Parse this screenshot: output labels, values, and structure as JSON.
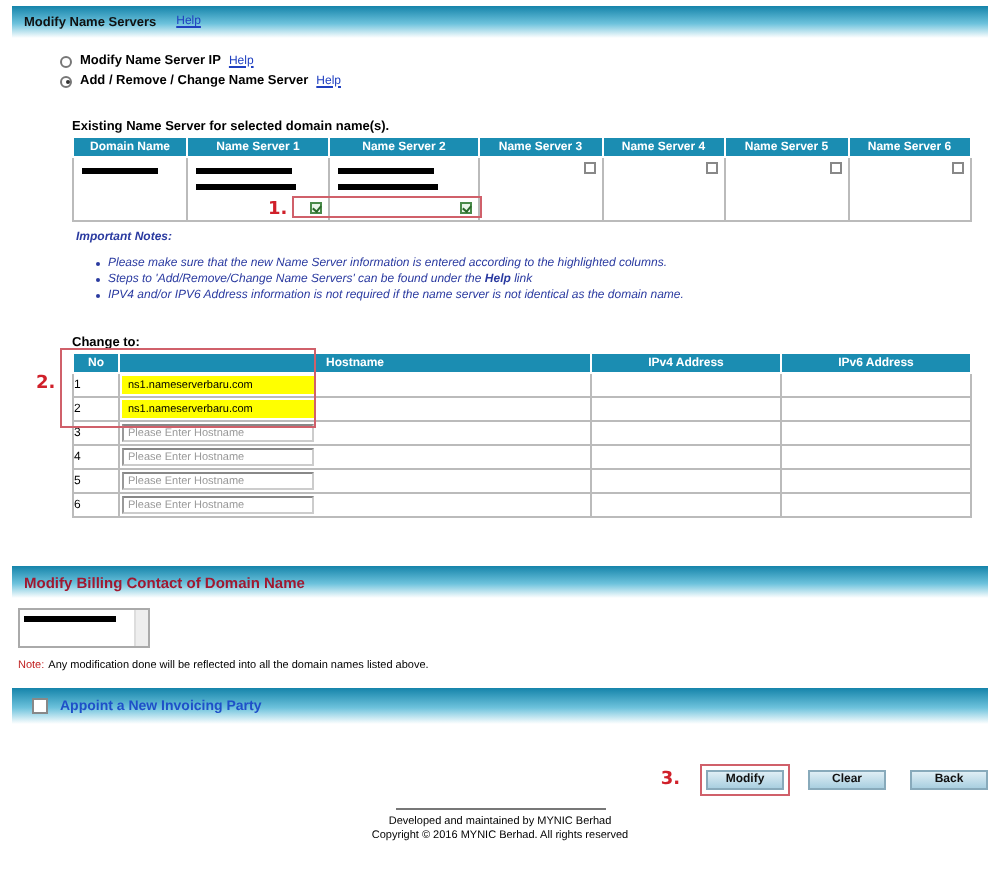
{
  "header": {
    "title": "Modify Name Servers",
    "help": "Help"
  },
  "options": [
    {
      "label": "Modify Name Server IP",
      "help": "Help",
      "selected": false
    },
    {
      "label": "Add / Remove / Change Name Server",
      "help": "Help",
      "selected": true
    }
  ],
  "existing": {
    "caption": "Existing Name Server for selected domain name(s).",
    "annotation": "1.",
    "columns": [
      "Domain Name",
      "Name Server 1",
      "Name Server 2",
      "Name Server 3",
      "Name Server 4",
      "Name Server 5",
      "Name Server 6"
    ],
    "servers": [
      {
        "kind": "filled",
        "checked": true
      },
      {
        "kind": "filled",
        "checked": true
      },
      {
        "kind": "empty",
        "checked": false
      },
      {
        "kind": "empty",
        "checked": false
      },
      {
        "kind": "empty",
        "checked": false
      },
      {
        "kind": "empty",
        "checked": false
      }
    ]
  },
  "notes": {
    "title": "Important Notes:",
    "items": [
      "Please make sure that the new Name Server information is entered according to the highlighted columns.",
      "Steps to 'Add/Remove/Change Name Servers' can be found under the **Help** link",
      "IPV4 and/or IPV6 Address information is not required if the name server is not identical as the domain name."
    ]
  },
  "change": {
    "caption": "Change to:",
    "annotation": "2.",
    "columns": [
      "No",
      "Hostname",
      "IPv4 Address",
      "IPv6 Address"
    ],
    "rows": [
      {
        "no": "1",
        "value": "ns1.nameserverbaru.com",
        "highlighted": true
      },
      {
        "no": "2",
        "value": "ns1.nameserverbaru.com",
        "highlighted": true
      },
      {
        "no": "3",
        "placeholder": "Please Enter Hostname",
        "highlighted": false
      },
      {
        "no": "4",
        "placeholder": "Please Enter Hostname",
        "highlighted": false
      },
      {
        "no": "5",
        "placeholder": "Please Enter Hostname",
        "highlighted": false
      },
      {
        "no": "6",
        "placeholder": "Please Enter Hostname",
        "highlighted": false
      }
    ]
  },
  "billing": {
    "title": "Modify Billing Contact of Domain Name",
    "note_label": "Note:",
    "note": "Any modification done will be reflected into all the domain names listed above."
  },
  "invoicing": {
    "label": "Appoint a New Invoicing Party",
    "checked": false
  },
  "actions": {
    "annotation": "3.",
    "buttons": [
      {
        "label": "Modify",
        "highlighted": true
      },
      {
        "label": "Clear",
        "highlighted": false
      },
      {
        "label": "Back",
        "highlighted": false
      }
    ]
  },
  "footer": [
    "Developed and maintained by MYNIC Berhad",
    "Copyright © 2016 MYNIC Berhad. All rights reserved"
  ]
}
